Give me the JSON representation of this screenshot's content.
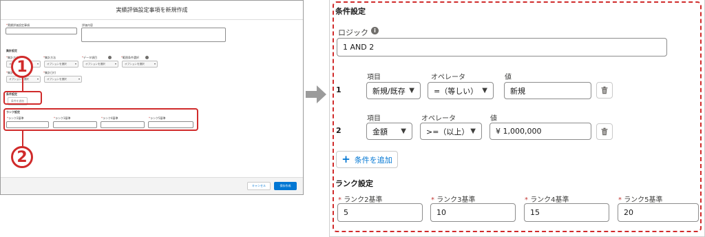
{
  "thumbnail": {
    "modal_title": "実績評価設定事項を新規作成",
    "field_labels": [
      "実績評価設定事項",
      "評価内容",
      "集計設定",
      "集計方法",
      "データ項目",
      "範囲条件選択",
      "集計種類",
      "集計日付",
      "条件設定",
      "ランク設定",
      "ランク2基準",
      "ランク3基準",
      "ランク4基準",
      "ランク5基準"
    ],
    "select_placeholder": "オプションを選択",
    "add_condition_label": "条件を追加",
    "cancel_label": "キャンセル",
    "save_label": "保存作成",
    "markers": [
      "1",
      "2"
    ]
  },
  "panel": {
    "section_title": "条件設定",
    "logic_label": "ロジック",
    "logic_value": "1 AND 2",
    "conditions": [
      {
        "number": "1",
        "field_label": "項目",
        "field_value": "新規/既存",
        "operator_label": "オペレータ",
        "operator_value": "=（等しい）",
        "value_label": "値",
        "value": "新規"
      },
      {
        "number": "2",
        "field_label": "項目",
        "field_value": "金額",
        "operator_label": "オペレータ",
        "operator_value": ">=（以上）",
        "value_label": "値",
        "value": "¥ 1,000,000"
      }
    ],
    "add_condition_label": "条件を追加",
    "rank_section_title": "ランク設定",
    "ranks": [
      {
        "label": "ランク2基準",
        "value": "5"
      },
      {
        "label": "ランク3基準",
        "value": "10"
      },
      {
        "label": "ランク4基準",
        "value": "15"
      },
      {
        "label": "ランク5基準",
        "value": "20"
      }
    ]
  },
  "colors": {
    "highlight_red": "#d02a2a",
    "brand_blue": "#0176d3",
    "arrow_gray": "#9b9b9b"
  },
  "icons": [
    "info-icon",
    "chevron-down-icon",
    "trash-icon",
    "plus-icon",
    "arrow-right-icon"
  ]
}
